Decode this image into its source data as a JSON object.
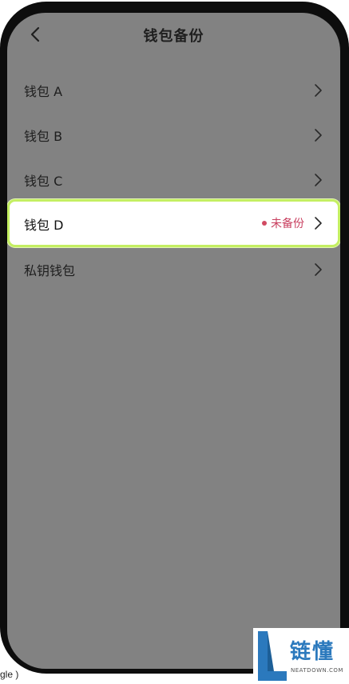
{
  "header": {
    "title": "钱包备份",
    "back_icon": "chevron-left-icon"
  },
  "wallets": [
    {
      "label": "钱包 A",
      "status": ""
    },
    {
      "label": "钱包 B",
      "status": ""
    },
    {
      "label": "钱包 C",
      "status": ""
    },
    {
      "label": "钱包 D",
      "status": "未备份"
    },
    {
      "label": "私钥钱包",
      "status": ""
    }
  ],
  "colors": {
    "screen_bg": "#828282",
    "highlight_border": "#c4ef62",
    "status_color": "#c94060"
  },
  "footer": {
    "side_text": "gle )"
  },
  "watermark": {
    "text": "链懂",
    "sub": "NEATDOWN.COM"
  }
}
